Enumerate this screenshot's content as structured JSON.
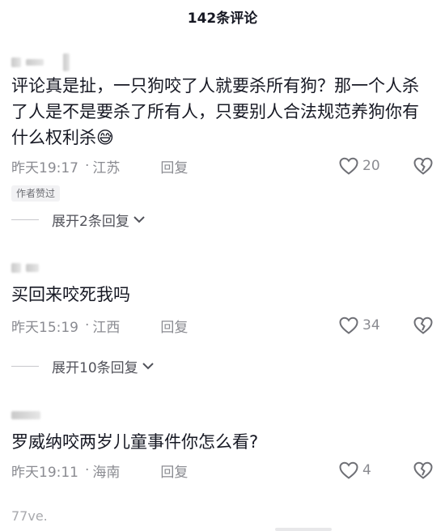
{
  "header": {
    "title": "142条评论"
  },
  "comments": [
    {
      "text": "评论真是扯，一只狗咬了人就要杀所有狗？那一个人杀了人是不是要杀了所有人，只要别人合法规范养狗你有什么权利杀",
      "emoji": "😅",
      "time": "昨天19:17",
      "location": "江苏",
      "reply_label": "回复",
      "likes": "20",
      "badge": "作者赞过",
      "expand_label": "展开2条回复"
    },
    {
      "text": "买回来咬死我吗",
      "time": "昨天15:19",
      "location": "江西",
      "reply_label": "回复",
      "likes": "34",
      "expand_label": "展开10条回复"
    },
    {
      "text": "罗威纳咬两岁儿童事件你怎么看?",
      "time": "昨天19:11",
      "location": "海南",
      "reply_label": "回复",
      "likes": "4"
    }
  ],
  "footer": {
    "partial_username": "77ve."
  },
  "icons": {
    "like": "heart-outline-icon",
    "dislike": "broken-heart-icon",
    "expand": "chevron-down-icon"
  },
  "colors": {
    "text": "#161823",
    "meta": "#8a8b91",
    "badge_bg": "#f2f2f4"
  },
  "separator": "·"
}
